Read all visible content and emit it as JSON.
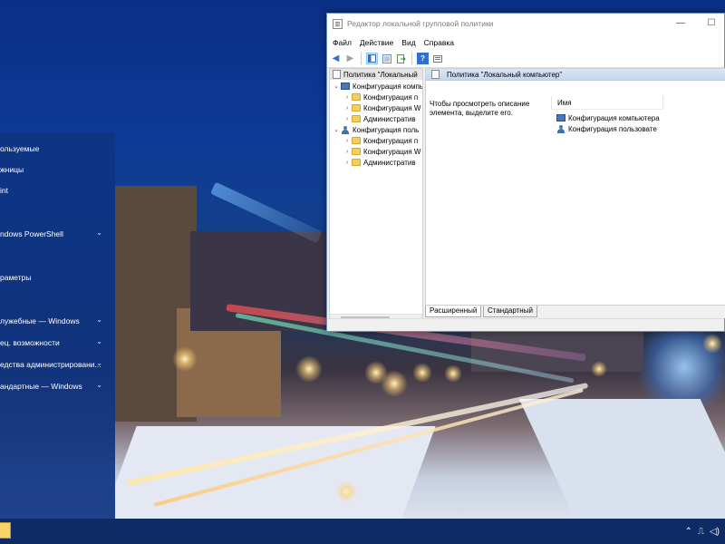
{
  "window": {
    "title": "Редактор локальной групповой политики",
    "menu": [
      "Файл",
      "Действие",
      "Вид",
      "Справка"
    ],
    "controls": {
      "minimize": "—",
      "maximize": "☐"
    }
  },
  "tree": {
    "root": "Политика \"Локальный",
    "items": [
      {
        "label": "Конфигурация компь",
        "level": 1,
        "expanded": true,
        "icon": "computer-icon"
      },
      {
        "label": "Конфигурация п",
        "level": 2,
        "expanded": false,
        "icon": "folder-icon"
      },
      {
        "label": "Конфигурация W",
        "level": 2,
        "expanded": false,
        "icon": "folder-icon"
      },
      {
        "label": "Административ",
        "level": 2,
        "expanded": false,
        "icon": "folder-icon"
      },
      {
        "label": "Конфигурация поль",
        "level": 1,
        "expanded": true,
        "icon": "user-icon"
      },
      {
        "label": "Конфигурация п",
        "level": 2,
        "expanded": false,
        "icon": "folder-icon"
      },
      {
        "label": "Конфигурация W",
        "level": 2,
        "expanded": false,
        "icon": "folder-icon"
      },
      {
        "label": "Административ",
        "level": 2,
        "expanded": false,
        "icon": "folder-icon"
      }
    ]
  },
  "content": {
    "header": "Политика \"Локальный компьютер\"",
    "description": "Чтобы просмотреть описание элемента, выделите его.",
    "column_name": "Имя",
    "items": [
      "Конфигурация компьютера",
      "Конфигурация пользовате"
    ]
  },
  "tabs": [
    "Расширенный",
    "Стандартный"
  ],
  "start_menu": {
    "items": [
      {
        "label": "ользуемые",
        "has_chevron": false
      },
      {
        "label": "жницы",
        "has_chevron": false
      },
      {
        "label": "int",
        "has_chevron": false
      },
      {
        "label": "ndows PowerShell",
        "has_chevron": true
      },
      {
        "label": "раметры",
        "has_chevron": false
      },
      {
        "label": "лужебные — Windows",
        "has_chevron": true
      },
      {
        "label": "ец. возможности",
        "has_chevron": true
      },
      {
        "label": "едства администрировани...",
        "has_chevron": true
      },
      {
        "label": "андартные — Windows",
        "has_chevron": true
      }
    ],
    "chevron": "⌄"
  },
  "taskbar": {
    "tray_icons": [
      "chevron-up-icon",
      "network-icon",
      "volume-icon"
    ],
    "tray_glyphs": {
      "chevron": "⌃",
      "network": "⎍",
      "volume": "◁)"
    }
  },
  "toolbar": {
    "icons": [
      "back-arrow-icon",
      "forward-arrow-icon",
      "show-hide-tree-icon",
      "properties-icon",
      "export-list-icon",
      "help-icon",
      "filter-view-icon"
    ],
    "glyphs": {
      "back": "◀",
      "forward": "▶",
      "help": "?"
    }
  }
}
